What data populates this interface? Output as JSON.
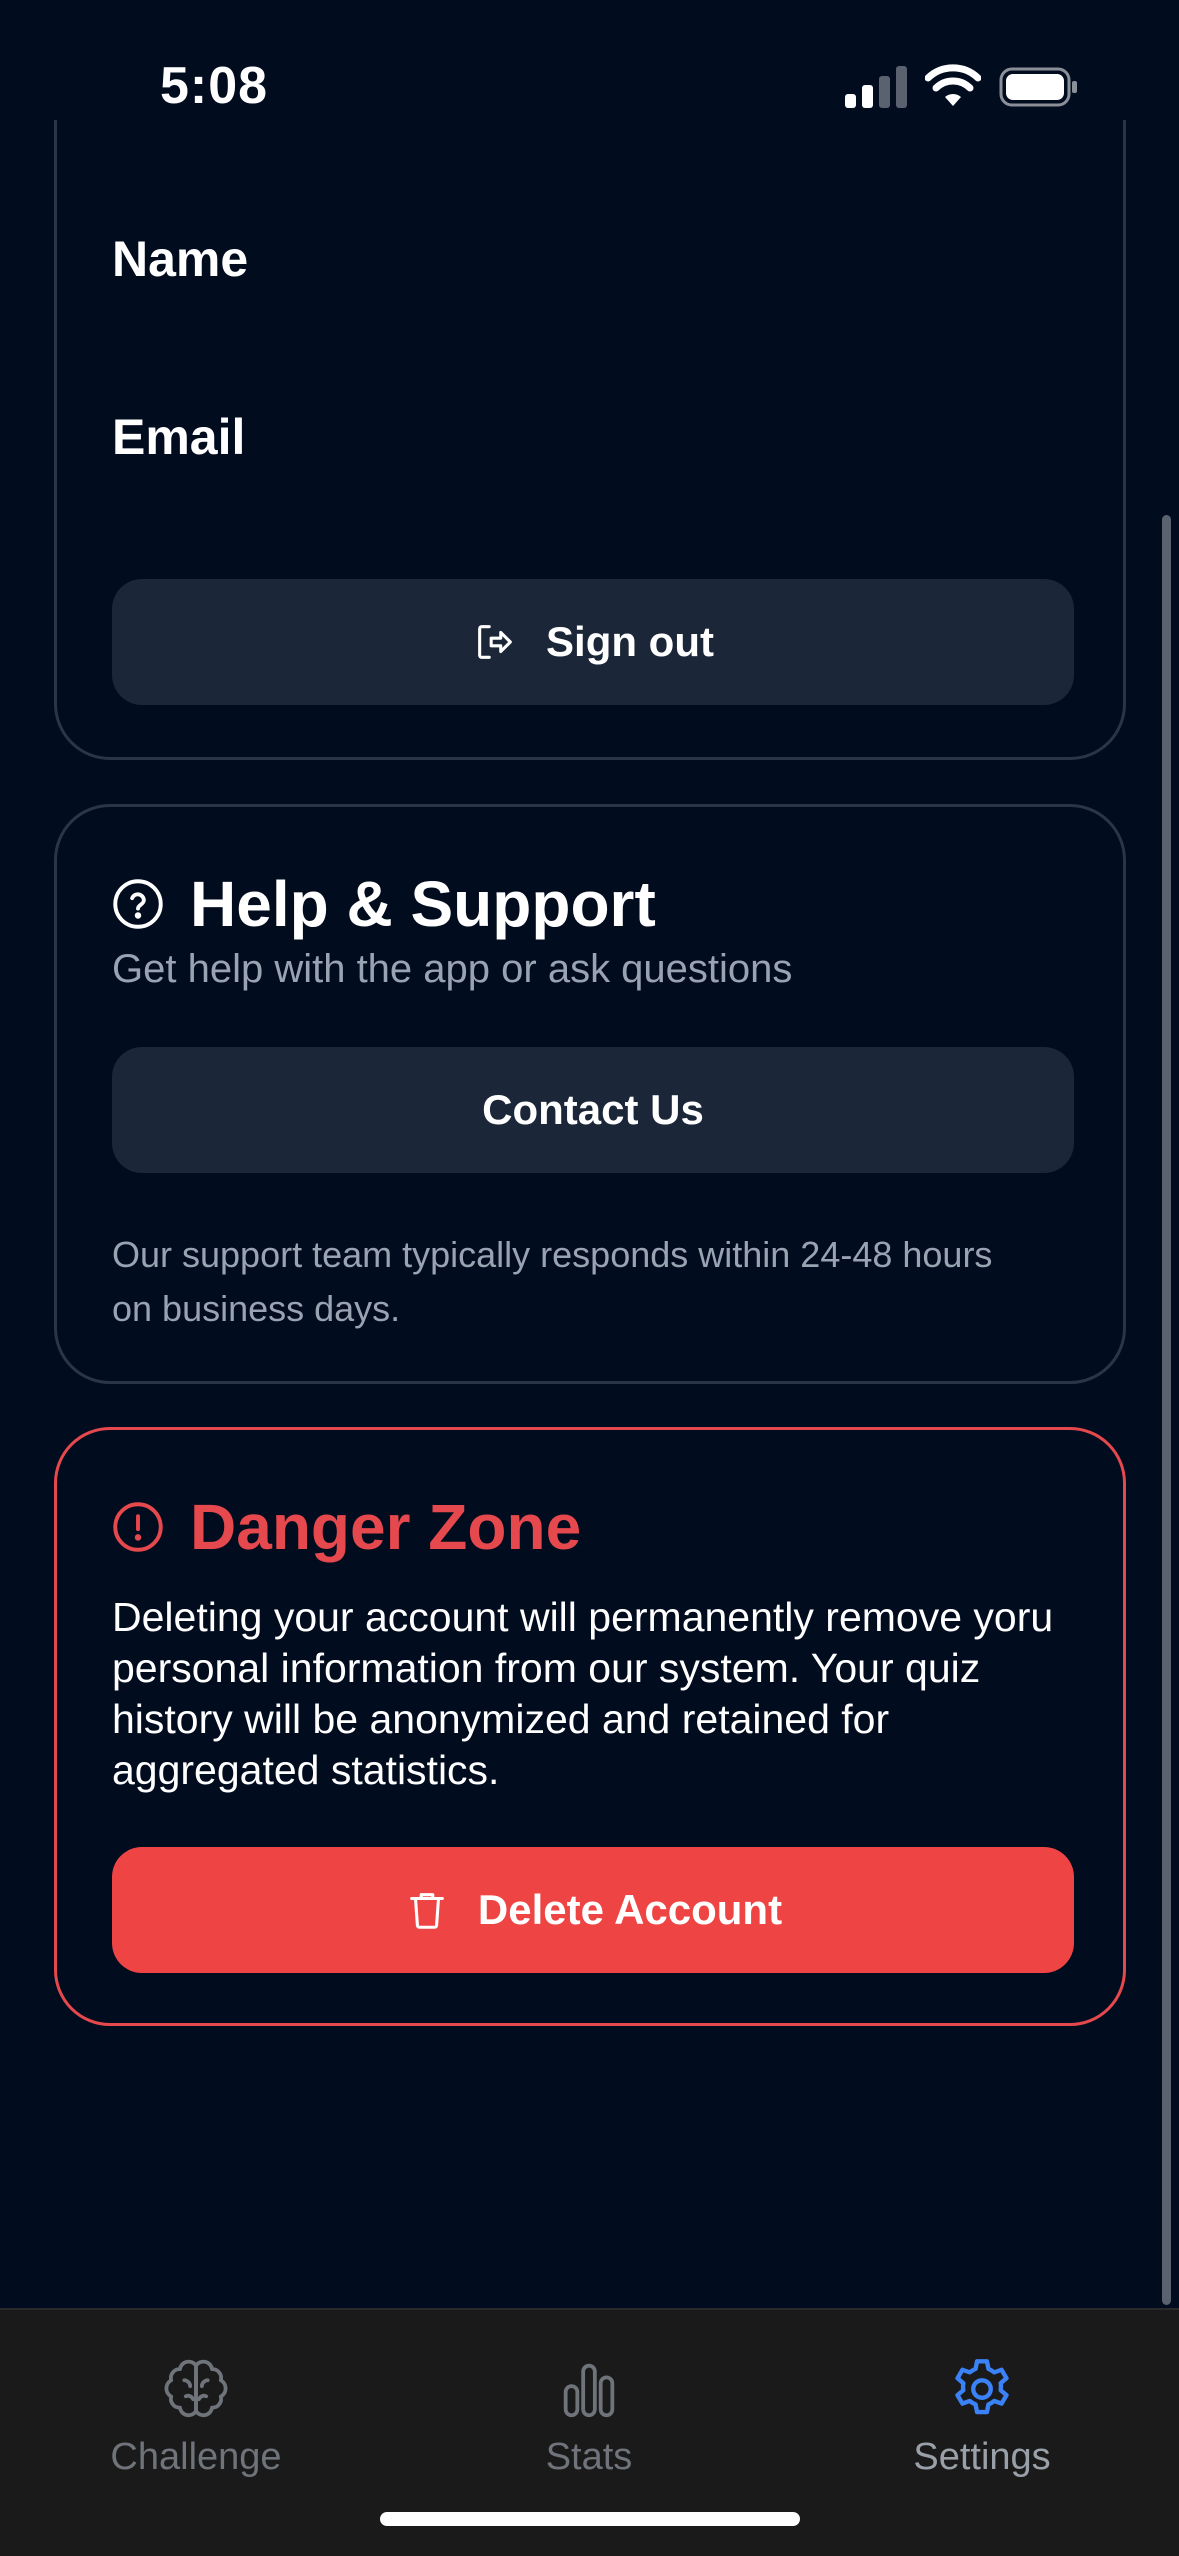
{
  "status_bar": {
    "time": "5:08",
    "icons": [
      "cellular-signal-icon",
      "wifi-icon",
      "battery-icon"
    ]
  },
  "account": {
    "name_label": "Name",
    "email_label": "Email",
    "sign_out_label": "Sign out",
    "sign_out_icon": "sign-out-icon"
  },
  "help": {
    "title": "Help & Support",
    "icon": "question-circle-icon",
    "subtitle": "Get help with the app or ask questions",
    "contact_label": "Contact Us",
    "note": "Our support team typically responds within 24-48 hours on business days."
  },
  "danger": {
    "title": "Danger Zone",
    "icon": "alert-circle-icon",
    "description": "Deleting your account will permanently remove yoru personal information from our system. Your quiz history will be anonymized and retained for aggregated statistics.",
    "delete_label": "Delete Account",
    "delete_icon": "trash-icon"
  },
  "tabs": [
    {
      "label": "Challenge",
      "icon": "brain-icon",
      "active": false
    },
    {
      "label": "Stats",
      "icon": "bar-chart-icon",
      "active": false
    },
    {
      "label": "Settings",
      "icon": "gear-icon",
      "active": true
    }
  ],
  "colors": {
    "background": "#020c1f",
    "button": "#1b2638",
    "danger": "#ef4444",
    "active_tab": "#3b82f6",
    "muted_text": "#9aa3b2"
  }
}
